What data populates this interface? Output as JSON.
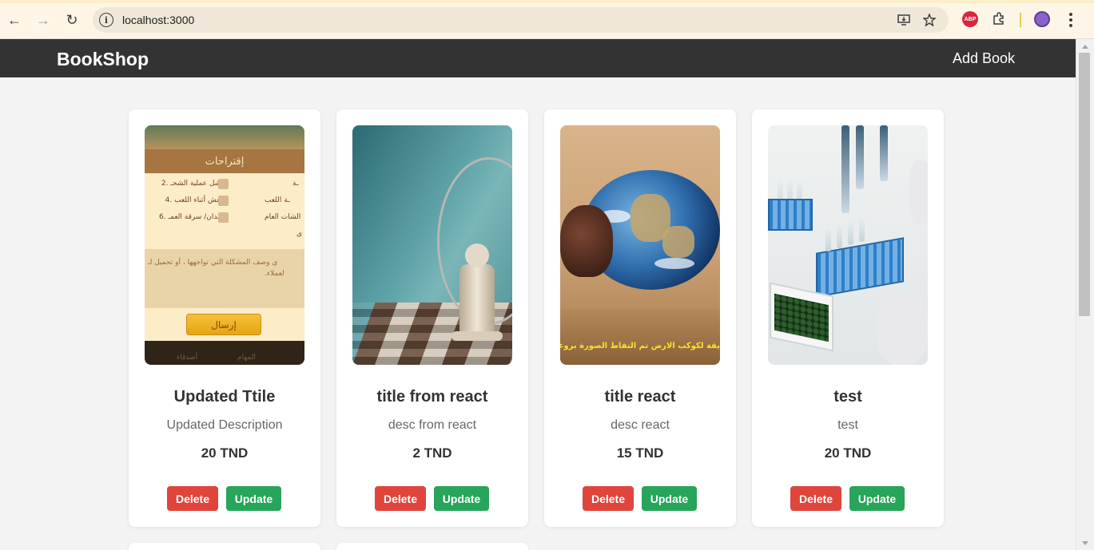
{
  "browser": {
    "url": "localhost:3000",
    "icons": [
      "back-icon",
      "forward-icon",
      "reload-icon",
      "site-info-icon",
      "install-icon",
      "bookmark-star-icon",
      "adblock-extension-icon",
      "extensions-puzzle-icon",
      "profile-icon",
      "menu-kebab-icon"
    ],
    "abp_label": "ABP"
  },
  "navbar": {
    "brand": "BookShop",
    "add_book": "Add Book",
    "background": "#333333"
  },
  "books": [
    {
      "title": "Updated Ttile",
      "description": "Updated Description",
      "price": "20 TND",
      "delete_label": "Delete",
      "update_label": "Update"
    },
    {
      "title": "title from react",
      "description": "desc from react",
      "price": "2 TND",
      "delete_label": "Delete",
      "update_label": "Update"
    },
    {
      "title": "title react",
      "description": "desc react",
      "price": "15 TND",
      "delete_label": "Delete",
      "update_label": "Update"
    },
    {
      "title": "test",
      "description": "test",
      "price": "20 TND",
      "delete_label": "Delete",
      "update_label": "Update"
    }
  ],
  "images": {
    "book1": {
      "header": "إقتراحات",
      "rows": [
        {
          "right": "2. فشل عملية الشحـ",
          "left": "ـة"
        },
        {
          "right": "4. الغش أثناء اللعب",
          "left": "ـة اللعب"
        },
        {
          "right": "6. فقدان/ سرقة العمـ",
          "left": "الشات العام"
        },
        {
          "right": "",
          "left": "ى"
        }
      ],
      "textarea_line1": "ى وصف المشكلة التي تواجهها ، أو تحميل لـ",
      "textarea_line2": "لعملاء.",
      "send_label": "إرسال",
      "bottom_labels": [
        "أصدقاء",
        "المهام"
      ]
    },
    "book3": {
      "caption": "يقة لكوكب الارض تم التقاط الصورة بروعاية لتلـ"
    }
  },
  "colors": {
    "delete": "#e0453c",
    "update": "#27a55a",
    "page_background": "#f3f3f3"
  }
}
